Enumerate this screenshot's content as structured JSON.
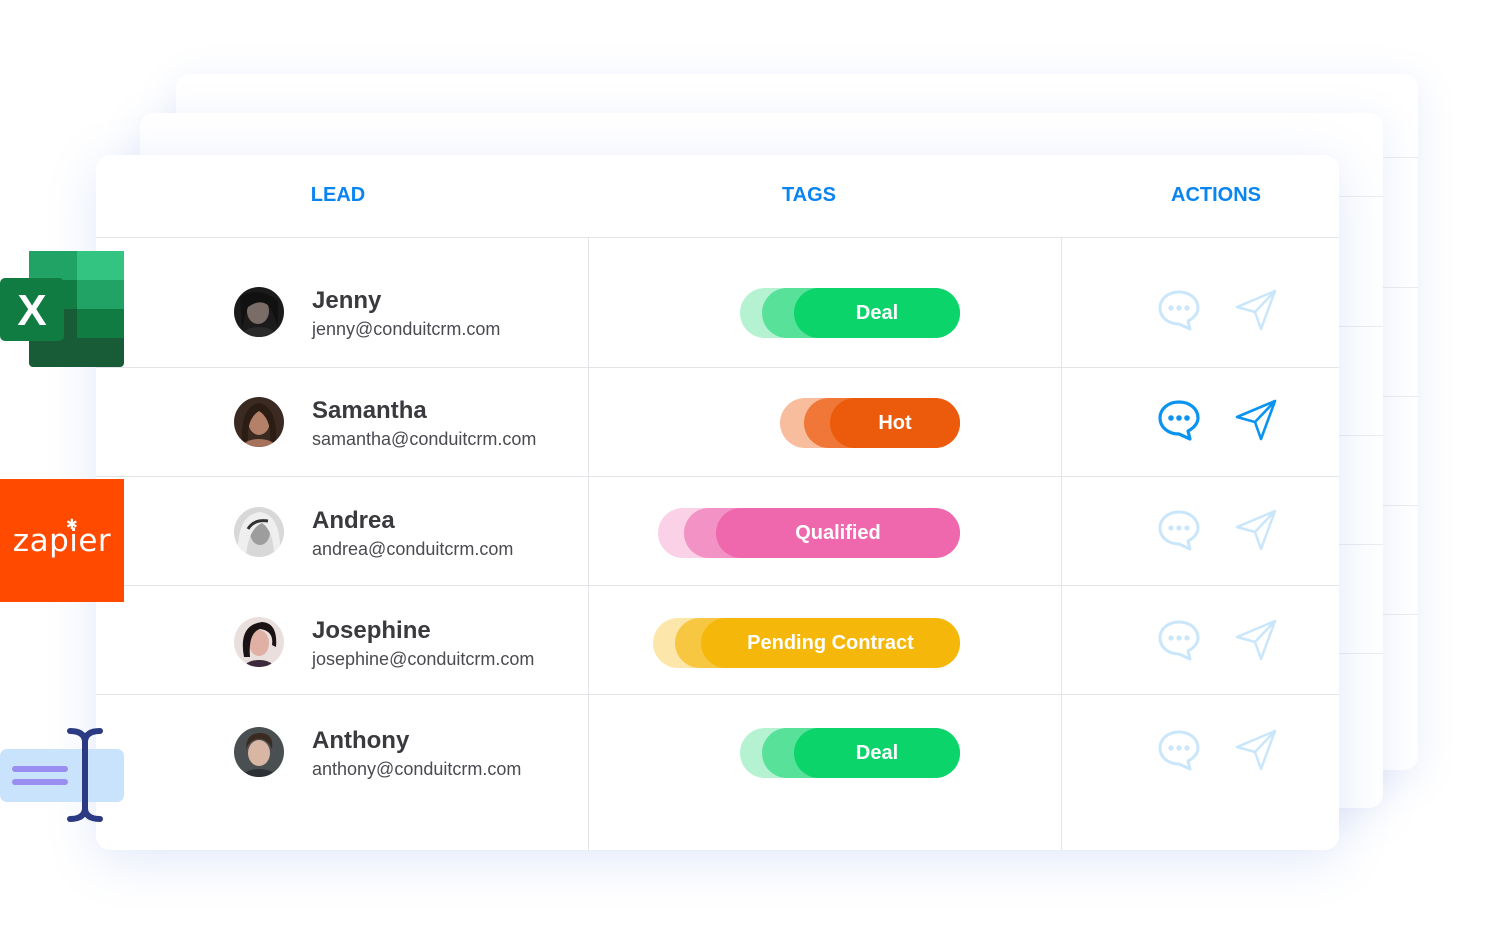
{
  "columns": {
    "lead": "LEAD",
    "tags": "TAGS",
    "actions": "ACTIONS"
  },
  "rows": [
    {
      "name": "Jenny",
      "email": "jenny@conduitcrm.com",
      "tag": "Deal",
      "tag_color": "#0bd46a",
      "actions_active": false
    },
    {
      "name": "Samantha",
      "email": "samantha@conduitcrm.com",
      "tag": "Hot",
      "tag_color": "#ec5a0b",
      "actions_active": true
    },
    {
      "name": "Andrea",
      "email": "andrea@conduitcrm.com",
      "tag": "Qualified",
      "tag_color": "#ef68ad",
      "actions_active": false
    },
    {
      "name": "Josephine",
      "email": "josephine@conduitcrm.com",
      "tag": "Pending Contract",
      "tag_color": "#f5b70a",
      "actions_active": false
    },
    {
      "name": "Anthony",
      "email": "anthony@conduitcrm.com",
      "tag": "Deal",
      "tag_color": "#0bd46a",
      "actions_active": false
    }
  ],
  "integrations": {
    "excel": {
      "letter": "X",
      "icon": "excel-icon"
    },
    "zapier": {
      "label": "zapier",
      "icon": "zapier-icon",
      "color": "#ff4a00"
    },
    "forms": {
      "icon": "text-field-icon"
    }
  },
  "colors": {
    "accent": "#0a84f0",
    "inactive_icon": "#c9e6fb"
  }
}
